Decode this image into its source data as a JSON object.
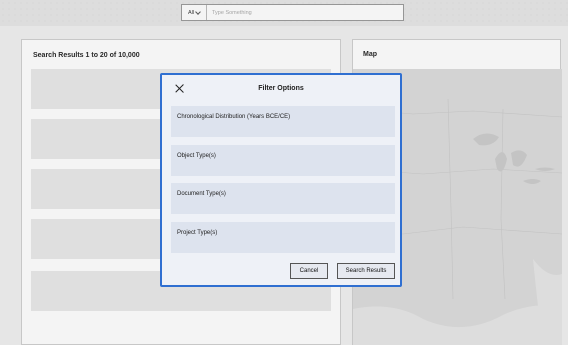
{
  "search": {
    "scope_label": "All",
    "placeholder": "Type Something"
  },
  "results": {
    "heading": "Search Results 1 to 20 of 10,000"
  },
  "map": {
    "heading": "Map"
  },
  "modal": {
    "title": "Filter Options",
    "filters": [
      "Chronological Distribution (Years BCE/CE)",
      "Object Type(s)",
      "Document Type(s)",
      "Project Type(s)"
    ],
    "cancel_label": "Cancel",
    "search_label": "Search Results"
  },
  "colors": {
    "modal_border": "#2f6fd1",
    "modal_bg": "#eef1f7",
    "filter_row_bg": "#dde3ee",
    "placeholder_card": "#e9e9e9"
  }
}
